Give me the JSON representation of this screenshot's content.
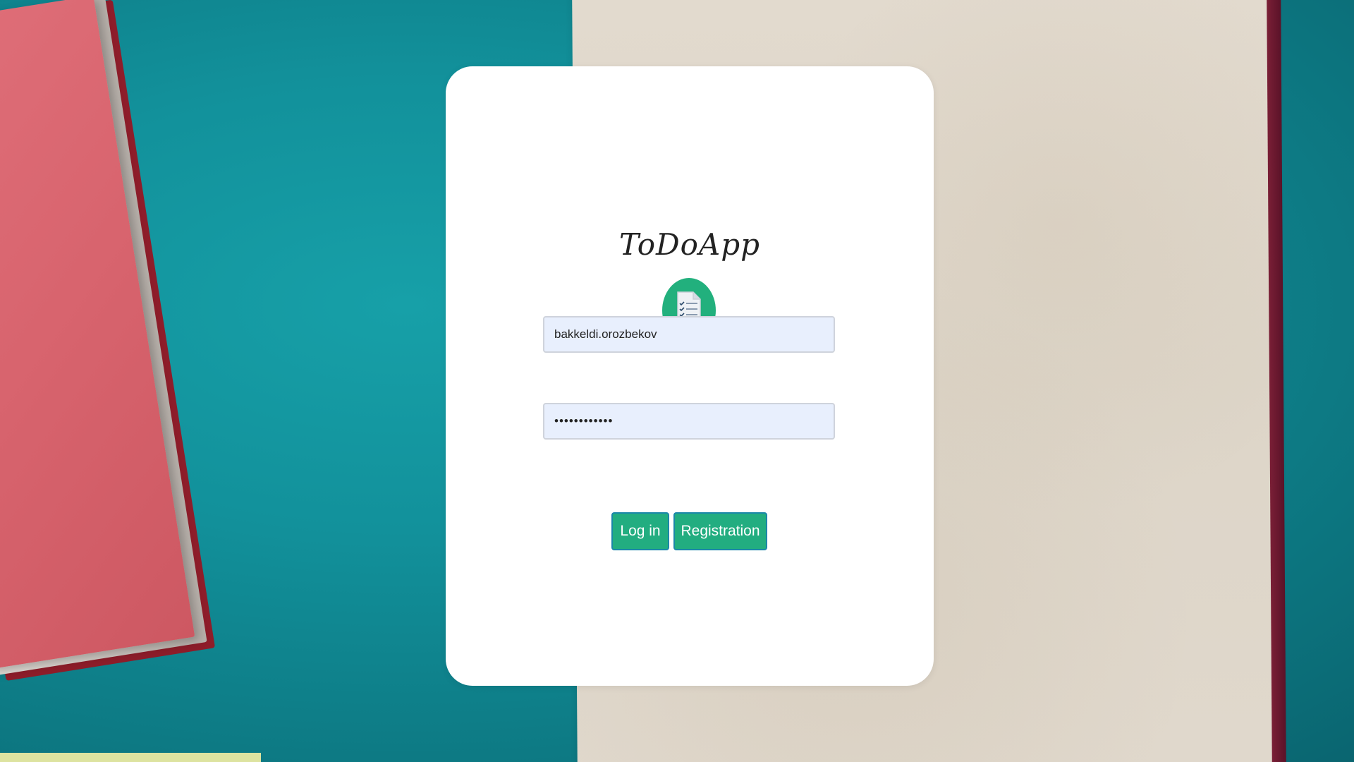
{
  "app": {
    "title": "ToDoApp",
    "logo_icon": "checklist-document-icon",
    "accent_color": "#22ad80"
  },
  "login_form": {
    "username_value": "bakkeldi.orozbekov",
    "password_value": "••••••••••••"
  },
  "buttons": {
    "login_label": "Log in",
    "registration_label": "Registration"
  }
}
